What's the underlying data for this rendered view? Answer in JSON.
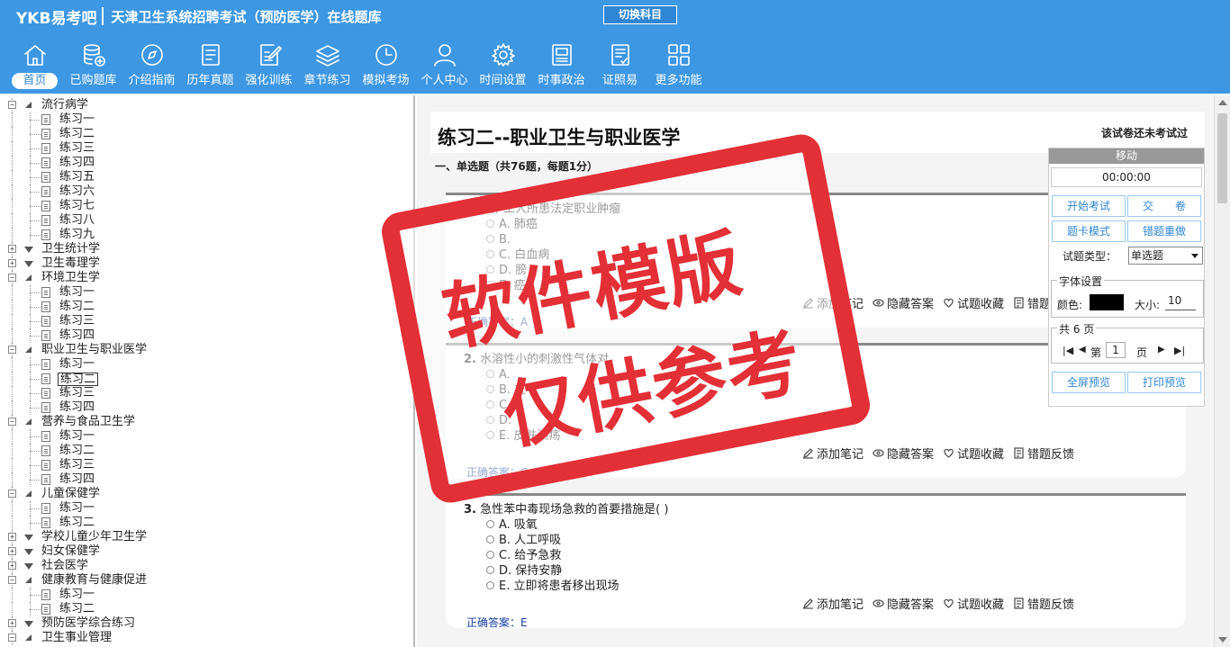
{
  "header": {
    "logo": "YKB易考吧",
    "title": "天津卫生系统招聘考试（预防医学）在线题库",
    "switch_label": "切换科目"
  },
  "nav": [
    {
      "label": "首页",
      "icon": "home-icon",
      "active": true
    },
    {
      "label": "已购题库",
      "icon": "database-add-icon"
    },
    {
      "label": "介绍指南",
      "icon": "compass-icon"
    },
    {
      "label": "历年真题",
      "icon": "document-list-icon"
    },
    {
      "label": "强化训练",
      "icon": "edit-document-icon"
    },
    {
      "label": "章节练习",
      "icon": "layers-icon"
    },
    {
      "label": "模拟考场",
      "icon": "clock-icon"
    },
    {
      "label": "个人中心",
      "icon": "user-icon"
    },
    {
      "label": "时间设置",
      "icon": "gear-icon"
    },
    {
      "label": "时事政治",
      "icon": "newspaper-icon"
    },
    {
      "label": "证照易",
      "icon": "certificate-icon"
    },
    {
      "label": "更多功能",
      "icon": "grid-icon"
    }
  ],
  "tree": [
    {
      "label": "流行病学",
      "open": true,
      "children": [
        "练习一",
        "练习二",
        "练习三",
        "练习四",
        "练习五",
        "练习六",
        "练习七",
        "练习八",
        "练习九"
      ]
    },
    {
      "label": "卫生统计学",
      "open": false
    },
    {
      "label": "卫生毒理学",
      "open": false
    },
    {
      "label": "环境卫生学",
      "open": true,
      "children": [
        "练习一",
        "练习二",
        "练习三",
        "练习四"
      ]
    },
    {
      "label": "职业卫生与职业医学",
      "open": true,
      "children": [
        "练习一",
        "练习二",
        "练习三",
        "练习四"
      ],
      "selected": 1
    },
    {
      "label": "营养与食品卫生学",
      "open": true,
      "children": [
        "练习一",
        "练习二",
        "练习三",
        "练习四"
      ]
    },
    {
      "label": "儿童保健学",
      "open": true,
      "children": [
        "练习一",
        "练习二"
      ]
    },
    {
      "label": "学校儿童少年卫生学",
      "open": false
    },
    {
      "label": "妇女保健学",
      "open": false
    },
    {
      "label": "社会医学",
      "open": false
    },
    {
      "label": "健康教育与健康促进",
      "open": true,
      "children": [
        "练习一",
        "练习二"
      ]
    },
    {
      "label": "预防医学综合练习",
      "open": false
    },
    {
      "label": "卫生事业管理",
      "open": true
    }
  ],
  "paper": {
    "title": "练习二--职业卫生与职业医学",
    "status": "该试卷还未考试过",
    "section": "一、单选题（共76题，每题1分）"
  },
  "tools": {
    "note": "添加笔记",
    "hide": "隐藏答案",
    "fav": "试题收藏",
    "report": "错题反馈"
  },
  "answer_label": "正确答案：",
  "questions": [
    {
      "num": "1.",
      "text": "焦炉工人所患法定职业肿瘤",
      "options": [
        "A. 肺癌",
        "B.",
        "C. 白血病",
        "D. 膀",
        "E.  癌"
      ],
      "answer": "A"
    },
    {
      "num": "2.",
      "text": "水溶性小的刺激性气体对",
      "options": [
        "A.",
        "B. 支",
        "C.",
        "D.",
        "E. 皮肤溃疡"
      ],
      "answer": "C"
    },
    {
      "num": "3.",
      "text": "急性苯中毒现场急救的首要措施是( )",
      "options": [
        "A. 吸氧",
        "B. 人工呼吸",
        "C. 给予急救",
        "D. 保持安静",
        "E. 立即将患者移出现场"
      ],
      "answer": "E"
    }
  ],
  "panel": {
    "move": "移动",
    "timer": "00:00:00",
    "start": "开始考试",
    "submit": "交　　卷",
    "card_mode": "题卡模式",
    "redo": "错题重做",
    "type_label": "试题类型：",
    "type_value": "单选题",
    "font_legend": "字体设置",
    "color_label": "颜色:",
    "size_label": "大小:",
    "size_value": "10",
    "pages_legend": "共 6 页",
    "page_prefix": "第",
    "page_value": "1",
    "page_suffix": "页",
    "fullscreen": "全屏预览",
    "print": "打印预览"
  },
  "watermark": {
    "line1": "软件模版",
    "line2": "仅供参考",
    "color": "#e32f36"
  },
  "colors": {
    "header": "#3d97e3",
    "accent": "#2f86d4",
    "answer": "#1a3ea0"
  }
}
